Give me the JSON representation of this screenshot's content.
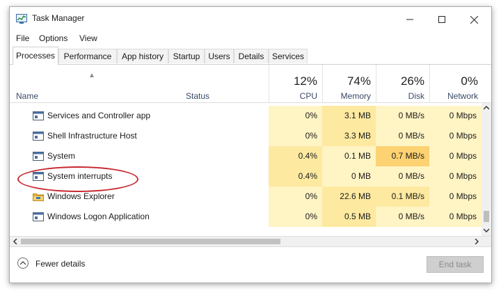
{
  "window": {
    "title": "Task Manager"
  },
  "menu": [
    "File",
    "Options",
    "View"
  ],
  "tabs": [
    "Processes",
    "Performance",
    "App history",
    "Startup",
    "Users",
    "Details",
    "Services"
  ],
  "columns": {
    "name": "Name",
    "status": "Status",
    "cpu": {
      "pct": "12%",
      "label": "CPU"
    },
    "memory": {
      "pct": "74%",
      "label": "Memory"
    },
    "disk": {
      "pct": "26%",
      "label": "Disk"
    },
    "network": {
      "pct": "0%",
      "label": "Network"
    }
  },
  "colors": {
    "highlight_light": "#fff4c4",
    "highlight_mid": "#fde9a0",
    "highlight_strong": "#fcd272",
    "annotation": "#c8282f"
  },
  "rows": [
    {
      "name": "Services and Controller app",
      "icon": "service-window-icon",
      "cpu": "0%",
      "memory": "3.1 MB",
      "disk": "0 MB/s",
      "network": "0 Mbps"
    },
    {
      "name": "Shell Infrastructure Host",
      "icon": "service-window-icon",
      "cpu": "0%",
      "memory": "3.3 MB",
      "disk": "0 MB/s",
      "network": "0 Mbps"
    },
    {
      "name": "System",
      "icon": "service-window-icon",
      "cpu": "0.4%",
      "memory": "0.1 MB",
      "disk": "0.7 MB/s",
      "network": "0 Mbps"
    },
    {
      "name": "System interrupts",
      "icon": "service-window-icon",
      "cpu": "0.4%",
      "memory": "0 MB",
      "disk": "0 MB/s",
      "network": "0 Mbps"
    },
    {
      "name": "Windows Explorer",
      "icon": "folder-icon",
      "cpu": "0%",
      "memory": "22.6 MB",
      "disk": "0.1 MB/s",
      "network": "0 Mbps"
    },
    {
      "name": "Windows Logon Application",
      "icon": "service-window-icon",
      "cpu": "0%",
      "memory": "0.5 MB",
      "disk": "0 MB/s",
      "network": "0 Mbps"
    }
  ],
  "footer": {
    "fewer_details": "Fewer details",
    "end_task": "End task"
  }
}
